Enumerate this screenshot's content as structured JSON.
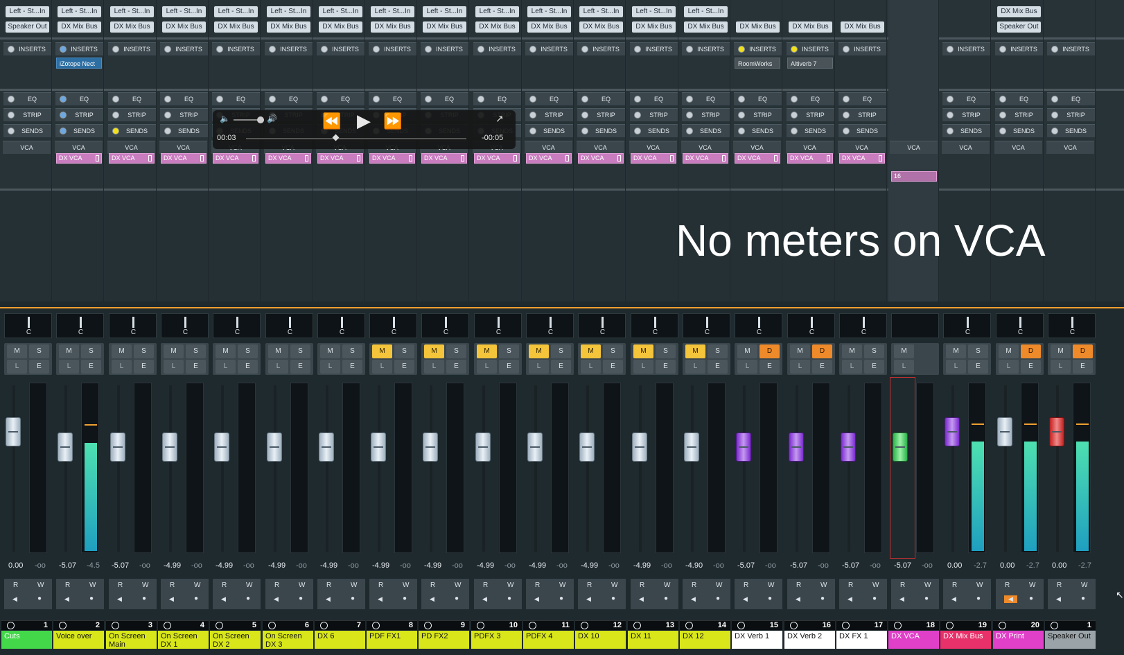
{
  "overlay_note": "No meters on VCA",
  "transport": {
    "elapsed": "00:03",
    "remaining": "-00:05"
  },
  "labels": {
    "inserts": "INSERTS",
    "eq": "EQ",
    "strip": "STRIP",
    "sends": "SENDS",
    "vca": "VCA",
    "pan": "C",
    "mute": "M",
    "solo": "S",
    "listen": "L",
    "edit": "E",
    "read": "R",
    "write": "W",
    "dim": "D"
  },
  "colors": {
    "accent": "#f0a030",
    "meter": "#3fd2a8",
    "mute_on": "#f4c43a",
    "dim_on": "#ef8a2a"
  },
  "channels": [
    {
      "num": "1",
      "name": "Cuts",
      "name_color": "#43d84a",
      "input": "Left - St...In",
      "output": "Speaker Out",
      "insert": "",
      "vca": "",
      "fader": "0.00",
      "peak": "-oo",
      "cap": "white",
      "meter": 0,
      "mute": false,
      "dim": false,
      "ins_led": "white"
    },
    {
      "num": "2",
      "name": "Voice over",
      "name_color": "#d8e61a",
      "input": "Left - St...In",
      "output": "DX Mix Bus",
      "insert": "iZotope Nect",
      "vca": "DX VCA",
      "fader": "-5.07",
      "peak": "-4.5",
      "cap": "white",
      "meter": 0.65,
      "mute": false,
      "dim": false,
      "ins_led": "blue"
    },
    {
      "num": "3",
      "name": "On Screen Main",
      "name_color": "#d8e61a",
      "input": "Left - St...In",
      "output": "DX Mix Bus",
      "insert": "",
      "vca": "DX VCA",
      "fader": "-5.07",
      "peak": "-oo",
      "cap": "white",
      "meter": 0,
      "mute": false,
      "dim": false,
      "ins_led": "white"
    },
    {
      "num": "4",
      "name": "On Screen DX 1",
      "name_color": "#d8e61a",
      "input": "Left - St...In",
      "output": "DX Mix Bus",
      "insert": "",
      "vca": "DX VCA",
      "fader": "-4.99",
      "peak": "-oo",
      "cap": "white",
      "meter": 0,
      "mute": false,
      "dim": false,
      "ins_led": "white"
    },
    {
      "num": "5",
      "name": "On Screen DX 2",
      "name_color": "#d8e61a",
      "input": "Left - St...In",
      "output": "DX Mix Bus",
      "insert": "",
      "vca": "DX VCA",
      "fader": "-4.99",
      "peak": "-oo",
      "cap": "white",
      "meter": 0,
      "mute": false,
      "dim": false,
      "ins_led": "white"
    },
    {
      "num": "6",
      "name": "On Screen DX 3",
      "name_color": "#d8e61a",
      "input": "Left - St...In",
      "output": "DX Mix Bus",
      "insert": "",
      "vca": "DX VCA",
      "fader": "-4.99",
      "peak": "-oo",
      "cap": "white",
      "meter": 0,
      "mute": false,
      "dim": false,
      "ins_led": "white"
    },
    {
      "num": "7",
      "name": "DX 6",
      "name_color": "#d8e61a",
      "input": "Left - St...In",
      "output": "DX Mix Bus",
      "insert": "",
      "vca": "DX VCA",
      "fader": "-4.99",
      "peak": "-oo",
      "cap": "white",
      "meter": 0,
      "mute": false,
      "dim": false,
      "ins_led": "white"
    },
    {
      "num": "8",
      "name": "PDF FX1",
      "name_color": "#d8e61a",
      "input": "Left - St...In",
      "output": "DX Mix Bus",
      "insert": "",
      "vca": "DX VCA",
      "fader": "-4.99",
      "peak": "-oo",
      "cap": "white",
      "meter": 0,
      "mute": true,
      "dim": false,
      "ins_led": "white"
    },
    {
      "num": "9",
      "name": "PD FX2",
      "name_color": "#d8e61a",
      "input": "Left - St...In",
      "output": "DX Mix Bus",
      "insert": "",
      "vca": "DX VCA",
      "fader": "-4.99",
      "peak": "-oo",
      "cap": "white",
      "meter": 0,
      "mute": true,
      "dim": false,
      "ins_led": "white"
    },
    {
      "num": "10",
      "name": "PDFX 3",
      "name_color": "#d8e61a",
      "input": "Left - St...In",
      "output": "DX Mix Bus",
      "insert": "",
      "vca": "DX VCA",
      "fader": "-4.99",
      "peak": "-oo",
      "cap": "white",
      "meter": 0,
      "mute": true,
      "dim": false,
      "ins_led": "white"
    },
    {
      "num": "11",
      "name": "PDFX 4",
      "name_color": "#d8e61a",
      "input": "Left - St...In",
      "output": "DX Mix Bus",
      "insert": "",
      "vca": "DX VCA",
      "fader": "-4.99",
      "peak": "-oo",
      "cap": "white",
      "meter": 0,
      "mute": true,
      "dim": false,
      "ins_led": "white"
    },
    {
      "num": "12",
      "name": "DX 10",
      "name_color": "#d8e61a",
      "input": "Left - St...In",
      "output": "DX Mix Bus",
      "insert": "",
      "vca": "DX VCA",
      "fader": "-4.99",
      "peak": "-oo",
      "cap": "white",
      "meter": 0,
      "mute": true,
      "dim": false,
      "ins_led": "white"
    },
    {
      "num": "13",
      "name": "DX 11",
      "name_color": "#d8e61a",
      "input": "Left - St...In",
      "output": "DX Mix Bus",
      "insert": "",
      "vca": "DX VCA",
      "fader": "-4.99",
      "peak": "-oo",
      "cap": "white",
      "meter": 0,
      "mute": true,
      "dim": false,
      "ins_led": "white"
    },
    {
      "num": "14",
      "name": "DX 12",
      "name_color": "#d8e61a",
      "input": "Left - St...In",
      "output": "DX Mix Bus",
      "insert": "",
      "vca": "DX VCA",
      "fader": "-4.90",
      "peak": "-oo",
      "cap": "white",
      "meter": 0,
      "mute": true,
      "dim": false,
      "ins_led": "white"
    },
    {
      "num": "15",
      "name": "DX Verb 1",
      "name_color": "#ffffff",
      "input": "",
      "output": "DX Mix Bus",
      "insert": "RoomWorks",
      "vca": "DX VCA",
      "fader": "-5.07",
      "peak": "-oo",
      "cap": "purple",
      "meter": 0,
      "mute": false,
      "dim": true,
      "ins_led": "yel"
    },
    {
      "num": "16",
      "name": "DX Verb 2",
      "name_color": "#ffffff",
      "input": "",
      "output": "DX Mix Bus",
      "insert": "Altiverb 7",
      "vca": "DX VCA",
      "fader": "-5.07",
      "peak": "-oo",
      "cap": "purple",
      "meter": 0,
      "mute": false,
      "dim": true,
      "ins_led": "yel"
    },
    {
      "num": "17",
      "name": "DX FX 1",
      "name_color": "#ffffff",
      "input": "",
      "output": "DX Mix Bus",
      "insert": "",
      "vca": "DX VCA",
      "fader": "-5.07",
      "peak": "-oo",
      "cap": "purple",
      "meter": 0,
      "mute": false,
      "dim": false,
      "ins_led": "white"
    },
    {
      "num": "18",
      "name": "DX VCA",
      "name_color": "#e040c8",
      "input": "",
      "output": "",
      "insert": "",
      "vca": "",
      "fader": "-5.07",
      "peak": "-oo",
      "cap": "green",
      "meter": 0,
      "mute": false,
      "dim": false,
      "ins_led": "none",
      "is_vca": true,
      "vca_count": "16"
    },
    {
      "num": "19",
      "name": "DX Mix Bus",
      "name_color": "#e8306a",
      "input": "",
      "output": "",
      "insert": "",
      "vca": "",
      "fader": "0.00",
      "peak": "-2.7",
      "cap": "purple",
      "meter": 0.66,
      "mute": false,
      "dim": false,
      "ins_led": "white"
    },
    {
      "num": "20",
      "name": "DX Print",
      "name_color": "#e040c8",
      "input": "DX Mix Bus",
      "output": "Speaker Out",
      "insert": "",
      "vca": "",
      "fader": "0.00",
      "peak": "-2.7",
      "cap": "white",
      "meter": 0.66,
      "mute": false,
      "dim": true,
      "ins_led": "white",
      "rw_orange": true
    },
    {
      "num": "1",
      "name": "Speaker Out",
      "name_color": "#9aa3a7",
      "input": "",
      "output": "",
      "insert": "",
      "vca": "",
      "fader": "0.00",
      "peak": "-2.7",
      "cap": "red",
      "meter": 0.66,
      "mute": false,
      "dim": true,
      "ins_led": "white"
    }
  ]
}
